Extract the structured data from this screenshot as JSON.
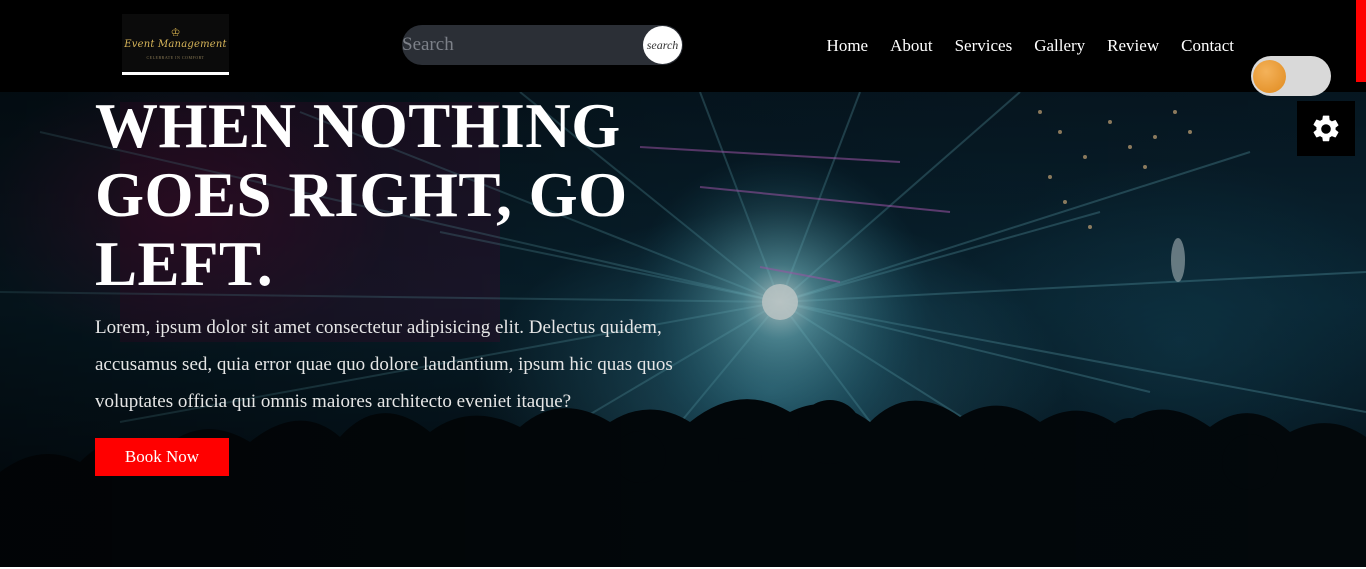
{
  "header": {
    "logo": {
      "text": "Event Management",
      "subtext": "CELEBRATE IN COMFORT"
    },
    "search": {
      "placeholder": "Search",
      "button_label": "search"
    },
    "nav": [
      {
        "label": "Home"
      },
      {
        "label": "About"
      },
      {
        "label": "Services"
      },
      {
        "label": "Gallery"
      },
      {
        "label": "Review"
      },
      {
        "label": "Contact"
      }
    ],
    "theme_toggle": {
      "state": "off",
      "knob_color": "#e8962e"
    }
  },
  "settings": {
    "icon": "gear-icon"
  },
  "hero": {
    "title": "WHEN NOTHING GOES RIGHT, GO LEFT.",
    "text": "Lorem, ipsum dolor sit amet consectetur adipisicing elit. Delectus quidem, accusamus sed, quia error quae quo dolore laudantium, ipsum hic quas quos voluptates officia qui omnis maiores architecto eveniet itaque?",
    "cta_label": "Book Now"
  },
  "colors": {
    "accent": "#ff0000",
    "header_bg": "#000000",
    "search_bg": "#2b2f36"
  }
}
